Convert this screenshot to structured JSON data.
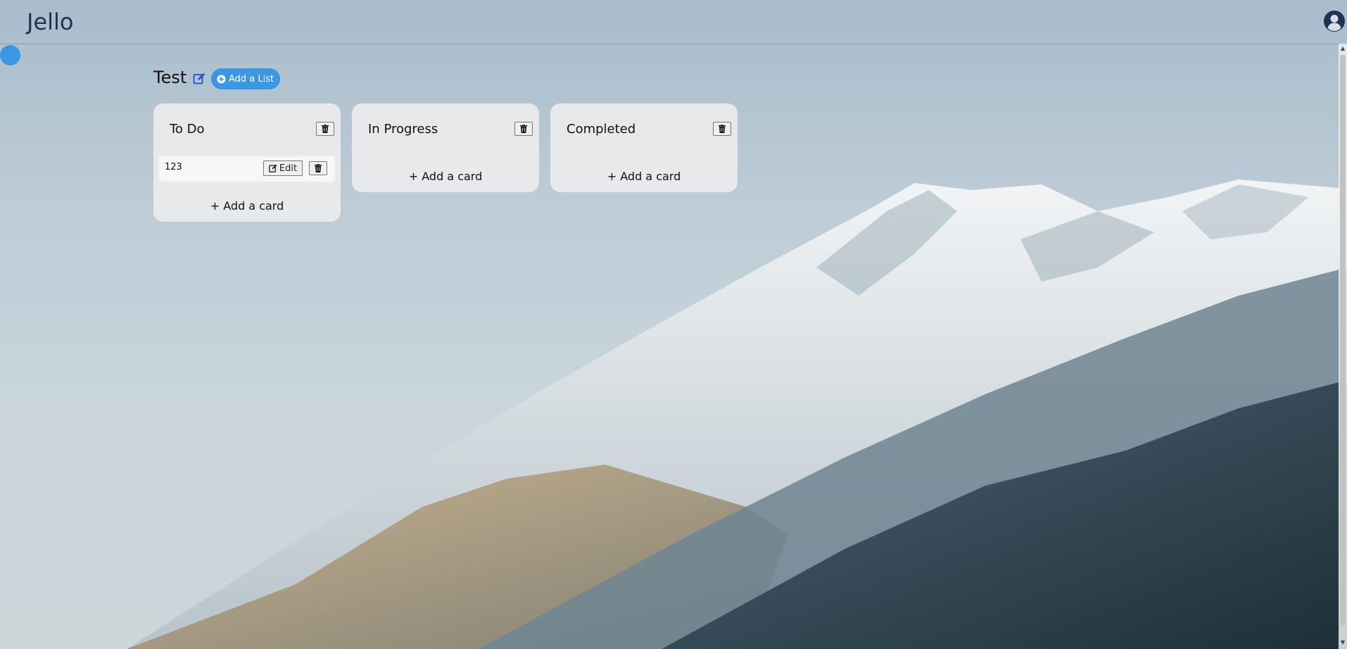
{
  "app": {
    "brand": "Jello"
  },
  "board": {
    "title": "Test",
    "add_list_label": "Add a List"
  },
  "lists": [
    {
      "title": "To Do",
      "cards": [
        {
          "text": "123",
          "edit_label": "Edit"
        }
      ],
      "add_card_label": "+ Add a card"
    },
    {
      "title": "In Progress",
      "cards": [],
      "add_card_label": "+ Add a card"
    },
    {
      "title": "Completed",
      "cards": [],
      "add_card_label": "+ Add a card"
    }
  ],
  "icons": {
    "user": "user-circle-icon",
    "edit_board": "pencil-square-icon",
    "add_list": "plus-circle-icon",
    "delete": "trash-icon",
    "edit_card": "pencil-square-icon"
  },
  "colors": {
    "accent": "#3b97e3",
    "brand_text": "#1f3450",
    "list_background": "#e8e9ea"
  }
}
